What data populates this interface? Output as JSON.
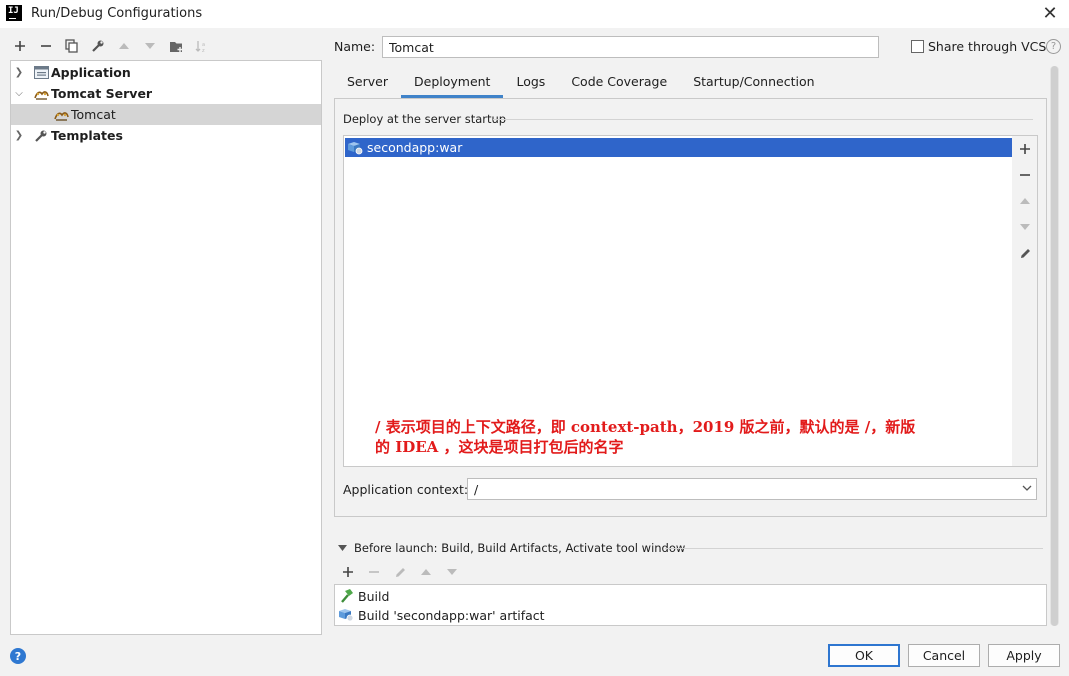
{
  "window": {
    "title": "Run/Debug Configurations",
    "logo_text": "IJ"
  },
  "toolbar": {
    "icons": [
      "plus-icon",
      "minus-icon",
      "copy-icon",
      "wrench-icon",
      "arrow-up-icon",
      "arrow-down-icon",
      "folder-add-icon",
      "sort-icon"
    ]
  },
  "tree": {
    "items": [
      {
        "label": "Application",
        "bold": true,
        "expanded": false,
        "icon": "application-icon"
      },
      {
        "label": "Tomcat Server",
        "bold": true,
        "expanded": true,
        "icon": "tomcat-icon"
      },
      {
        "label": "Tomcat",
        "bold": false,
        "selected": true,
        "icon": "tomcat-icon"
      },
      {
        "label": "Templates",
        "bold": true,
        "expanded": false,
        "icon": "wrench-icon"
      }
    ]
  },
  "name_field": {
    "label": "Name:",
    "value": "Tomcat"
  },
  "share": {
    "label": "Share through VCS",
    "checked": false,
    "help": "?"
  },
  "tabs": [
    {
      "label": "Server",
      "active": false
    },
    {
      "label": "Deployment",
      "active": true
    },
    {
      "label": "Logs",
      "active": false
    },
    {
      "label": "Code Coverage",
      "active": false
    },
    {
      "label": "Startup/Connection",
      "active": false
    }
  ],
  "deployment": {
    "group_title": "Deploy at the server startup",
    "items": [
      {
        "label": "secondapp:war",
        "selected": true,
        "icon": "artifact-icon"
      }
    ],
    "side_buttons": [
      "plus-icon",
      "minus-icon",
      "arrow-up-icon",
      "arrow-down-icon",
      "pencil-icon"
    ],
    "annotation_line1": "/ 表示项目的上下文路径，即 context-path，2019 版之前，默认的是 /，新版",
    "annotation_line2": "的 IDEA ，这块是项目打包后的名字",
    "context_label": "Application context:",
    "context_value": "/"
  },
  "before_launch": {
    "title": "Before launch: Build, Build Artifacts, Activate tool window",
    "toolbar_icons": [
      "plus-icon",
      "minus-icon",
      "pencil-icon",
      "arrow-up-icon",
      "arrow-down-icon"
    ],
    "items": [
      {
        "label": "Build",
        "icon": "hammer-icon"
      },
      {
        "label": "Build 'secondapp:war' artifact",
        "icon": "artifact-icon"
      }
    ]
  },
  "footer": {
    "help": "?",
    "ok": "OK",
    "cancel": "Cancel",
    "apply": "Apply"
  },
  "colors": {
    "selection": "#2f65ca",
    "tab_underline": "#4083c9",
    "annotation": "#e21b1b",
    "help_blue": "#2f78d1"
  }
}
